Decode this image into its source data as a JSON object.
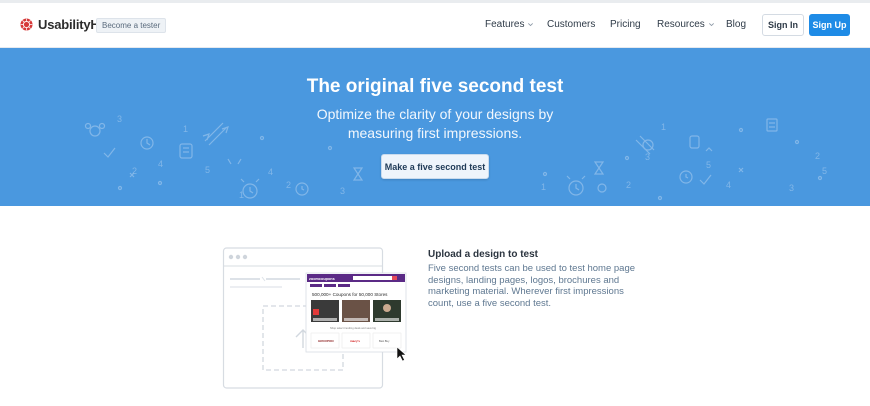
{
  "nav": {
    "brand": "UsabilityHub",
    "tester_badge": "Become a tester",
    "links": [
      {
        "label": "Features",
        "dropdown": true
      },
      {
        "label": "Customers",
        "dropdown": false
      },
      {
        "label": "Pricing",
        "dropdown": false
      },
      {
        "label": "Resources",
        "dropdown": true
      },
      {
        "label": "Blog",
        "dropdown": false
      }
    ],
    "signin_label": "Sign In",
    "signup_label": "Sign Up"
  },
  "hero": {
    "title": "The original five second test",
    "subtitle": "Optimize the clarity of your designs by measuring first impressions.",
    "cta_label": "Make a five second test"
  },
  "feature": {
    "title": "Upload a design to test",
    "description": "Five second tests can be used to test home page designs, landing pages, logos, brochures and marketing material. Wherever first impressions count, use a five second test.",
    "mockup": {
      "site_logo": "zoomcoupons",
      "headline": "500,000+ Coupons for 50,000 Stores",
      "caption": "Shop select trending deals and save big",
      "store_logos": [
        "GROUPON",
        "macy's",
        "Best Buy"
      ]
    }
  },
  "colors": {
    "hero_bg": "#4a98df",
    "signup_bg": "#1e8be6",
    "mockup_purple": "#5b2a86",
    "logo_red": "#d63a3a"
  }
}
